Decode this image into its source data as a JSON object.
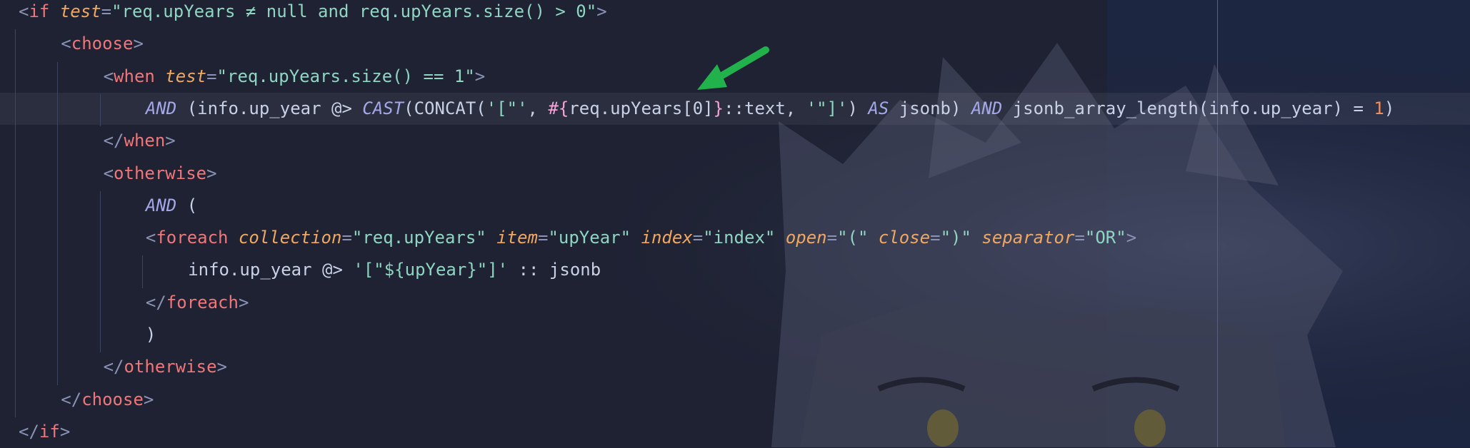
{
  "editor": {
    "lines": [
      {
        "indent": 0,
        "tokens": [
          {
            "t": "<",
            "c": "tk-p"
          },
          {
            "t": "if",
            "c": "tk-tag"
          },
          {
            "t": " ",
            "c": "tk-id"
          },
          {
            "t": "test",
            "c": "tk-attr"
          },
          {
            "t": "=",
            "c": "tk-p"
          },
          {
            "t": "\"req.upYears ≠ null and req.upYears.size() > 0\"",
            "c": "tk-str"
          },
          {
            "t": ">",
            "c": "tk-p"
          }
        ]
      },
      {
        "indent": 1,
        "tokens": [
          {
            "t": "<",
            "c": "tk-p"
          },
          {
            "t": "choose",
            "c": "tk-tag"
          },
          {
            "t": ">",
            "c": "tk-p"
          }
        ]
      },
      {
        "indent": 2,
        "tokens": [
          {
            "t": "<",
            "c": "tk-p"
          },
          {
            "t": "when",
            "c": "tk-tag"
          },
          {
            "t": " ",
            "c": "tk-id"
          },
          {
            "t": "test",
            "c": "tk-attr"
          },
          {
            "t": "=",
            "c": "tk-p"
          },
          {
            "t": "\"req.upYears.size() == 1\"",
            "c": "tk-str"
          },
          {
            "t": ">",
            "c": "tk-p"
          }
        ]
      },
      {
        "indent": 3,
        "current": true,
        "tokens": [
          {
            "t": "AND",
            "c": "tk-kw"
          },
          {
            "t": " (info.up_year @> ",
            "c": "tk-id"
          },
          {
            "t": "CAST",
            "c": "tk-kw"
          },
          {
            "t": "(CONCAT(",
            "c": "tk-fn"
          },
          {
            "t": "'[\"'",
            "c": "tk-lit"
          },
          {
            "t": ", ",
            "c": "tk-id"
          },
          {
            "t": "#{",
            "c": "tk-ph"
          },
          {
            "t": "req.upYears[0]",
            "c": "tk-id"
          },
          {
            "t": "}",
            "c": "tk-ph"
          },
          {
            "t": "::text, ",
            "c": "tk-id"
          },
          {
            "t": "'\"]'",
            "c": "tk-lit"
          },
          {
            "t": ") ",
            "c": "tk-id"
          },
          {
            "t": "AS",
            "c": "tk-kw"
          },
          {
            "t": " jsonb) ",
            "c": "tk-id"
          },
          {
            "t": "AND",
            "c": "tk-kw"
          },
          {
            "t": " jsonb_array_length(info.up_year) = ",
            "c": "tk-id"
          },
          {
            "t": "1",
            "c": "tk-num"
          },
          {
            "t": ")",
            "c": "tk-id"
          }
        ]
      },
      {
        "indent": 2,
        "tokens": [
          {
            "t": "</",
            "c": "tk-p"
          },
          {
            "t": "when",
            "c": "tk-tag"
          },
          {
            "t": ">",
            "c": "tk-p"
          }
        ]
      },
      {
        "indent": 2,
        "tokens": [
          {
            "t": "<",
            "c": "tk-p"
          },
          {
            "t": "otherwise",
            "c": "tk-tag"
          },
          {
            "t": ">",
            "c": "tk-p"
          }
        ]
      },
      {
        "indent": 3,
        "tokens": [
          {
            "t": "AND",
            "c": "tk-kw"
          },
          {
            "t": " (",
            "c": "tk-id"
          }
        ]
      },
      {
        "indent": 3,
        "tokens": [
          {
            "t": "<",
            "c": "tk-p"
          },
          {
            "t": "foreach",
            "c": "tk-tag"
          },
          {
            "t": " ",
            "c": "tk-id"
          },
          {
            "t": "collection",
            "c": "tk-attr"
          },
          {
            "t": "=",
            "c": "tk-p"
          },
          {
            "t": "\"req.upYears\"",
            "c": "tk-str"
          },
          {
            "t": " ",
            "c": "tk-id"
          },
          {
            "t": "item",
            "c": "tk-attr"
          },
          {
            "t": "=",
            "c": "tk-p"
          },
          {
            "t": "\"upYear\"",
            "c": "tk-str"
          },
          {
            "t": " ",
            "c": "tk-id"
          },
          {
            "t": "index",
            "c": "tk-attr"
          },
          {
            "t": "=",
            "c": "tk-p"
          },
          {
            "t": "\"index\"",
            "c": "tk-str"
          },
          {
            "t": " ",
            "c": "tk-id"
          },
          {
            "t": "open",
            "c": "tk-attr"
          },
          {
            "t": "=",
            "c": "tk-p"
          },
          {
            "t": "\"(\"",
            "c": "tk-str"
          },
          {
            "t": " ",
            "c": "tk-id"
          },
          {
            "t": "close",
            "c": "tk-attr"
          },
          {
            "t": "=",
            "c": "tk-p"
          },
          {
            "t": "\")\"",
            "c": "tk-str"
          },
          {
            "t": " ",
            "c": "tk-id"
          },
          {
            "t": "separator",
            "c": "tk-attr"
          },
          {
            "t": "=",
            "c": "tk-p"
          },
          {
            "t": "\"OR\"",
            "c": "tk-str"
          },
          {
            "t": ">",
            "c": "tk-p"
          }
        ]
      },
      {
        "indent": 4,
        "tokens": [
          {
            "t": "info.up_year @> ",
            "c": "tk-id"
          },
          {
            "t": "'[\"${upYear}\"]'",
            "c": "tk-lit"
          },
          {
            "t": " :: jsonb",
            "c": "tk-id"
          }
        ]
      },
      {
        "indent": 3,
        "tokens": [
          {
            "t": "</",
            "c": "tk-p"
          },
          {
            "t": "foreach",
            "c": "tk-tag"
          },
          {
            "t": ">",
            "c": "tk-p"
          }
        ]
      },
      {
        "indent": 3,
        "tokens": [
          {
            "t": ")",
            "c": "tk-id"
          }
        ]
      },
      {
        "indent": 2,
        "tokens": [
          {
            "t": "</",
            "c": "tk-p"
          },
          {
            "t": "otherwise",
            "c": "tk-tag"
          },
          {
            "t": ">",
            "c": "tk-p"
          }
        ]
      },
      {
        "indent": 1,
        "tokens": [
          {
            "t": "</",
            "c": "tk-p"
          },
          {
            "t": "choose",
            "c": "tk-tag"
          },
          {
            "t": ">",
            "c": "tk-p"
          }
        ]
      },
      {
        "indent": 0,
        "tokens": [
          {
            "t": "</",
            "c": "tk-p"
          },
          {
            "t": "if",
            "c": "tk-tag"
          },
          {
            "t": ">",
            "c": "tk-p"
          }
        ]
      }
    ]
  },
  "annotation": {
    "arrow_color": "#22b24c",
    "icon": "green-arrow-icon"
  },
  "colors": {
    "background": "#1e2233",
    "tag": "#f0767a",
    "attribute": "#f0a860",
    "string": "#8fd6c2",
    "keyword": "#a4a7e8",
    "number": "#f08f5a",
    "placeholder": "#f5a3d9"
  }
}
